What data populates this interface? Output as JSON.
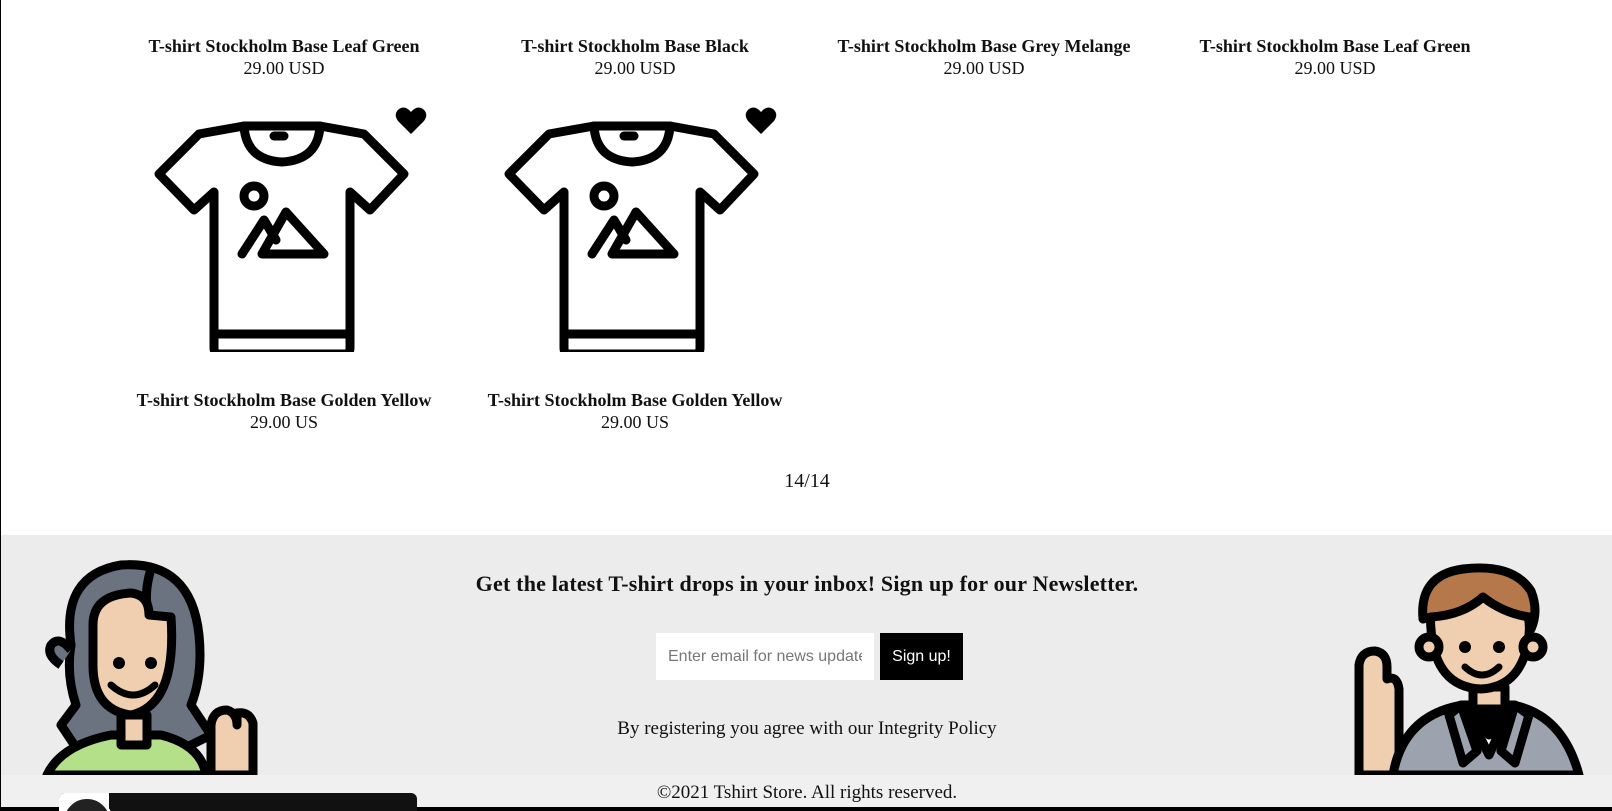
{
  "top_row": [
    {
      "name": "T-shirt Stockholm Base Leaf Green",
      "price": "29.00 USD"
    },
    {
      "name": "T-shirt Stockholm Base Black",
      "price": "29.00 USD"
    },
    {
      "name": "T-shirt Stockholm Base Grey Melange",
      "price": "29.00 USD"
    },
    {
      "name": "T-shirt Stockholm Base Leaf Green",
      "price": "29.00 USD"
    }
  ],
  "bottom_row": [
    {
      "name": "T-shirt Stockholm Base Golden Yellow",
      "price": "29.00 US",
      "icon": "tshirt-placeholder-icon",
      "favorite_icon": "heart-icon"
    },
    {
      "name": "T-shirt Stockholm Base Golden Yellow",
      "price": "29.00 US",
      "icon": "tshirt-placeholder-icon",
      "favorite_icon": "heart-icon"
    }
  ],
  "pagination": {
    "label": "14/14"
  },
  "newsletter": {
    "title": "Get the latest T-shirt drops in your inbox! Sign up for our Newsletter.",
    "email_placeholder": "Enter email for news updates",
    "signup_label": "Sign up!",
    "agree_prefix": "By registering you agree with our ",
    "agree_link": "Integrity Policy"
  },
  "footer": {
    "copyright": "©2021 Tshirt Store. All rights reserved."
  },
  "colors": {
    "footer_bg": "#ececec",
    "button_bg": "#000000",
    "woman_hair": "#6b7280",
    "skin": "#f0cfb0",
    "woman_shirt": "#b5e08a",
    "man_hair": "#b5784a",
    "man_suit": "#9ca3af"
  }
}
